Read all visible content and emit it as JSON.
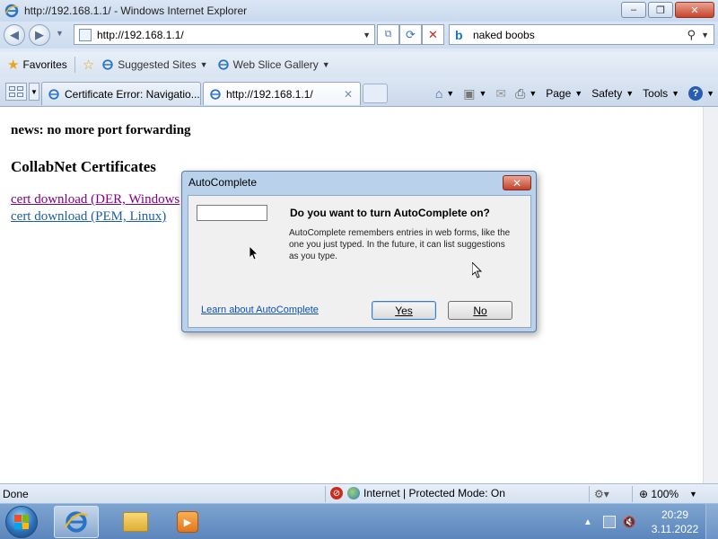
{
  "window": {
    "title": "http://192.168.1.1/ - Windows Internet Explorer",
    "minimize_label": "‒",
    "maximize_label": "❐",
    "close_label": "✕"
  },
  "address_bar": {
    "url": "http://192.168.1.1/",
    "search_query": "naked boobs",
    "search_engine_icon": "bing-icon"
  },
  "favorites_bar": {
    "favorites_label": "Favorites",
    "items": [
      {
        "label": "Suggested Sites"
      },
      {
        "label": "Web Slice Gallery"
      }
    ]
  },
  "tabs": [
    {
      "label": "Certificate Error: Navigatio...",
      "active": false
    },
    {
      "label": "http://192.168.1.1/",
      "active": true
    }
  ],
  "command_bar": {
    "page_label": "Page",
    "safety_label": "Safety",
    "tools_label": "Tools",
    "help_label": "?"
  },
  "page": {
    "news": "news: no more port forwarding",
    "heading": "CollabNet Certificates",
    "links": [
      {
        "label": "cert download (DER, Windows"
      },
      {
        "label": "cert download (PEM, Linux)"
      }
    ]
  },
  "dialog": {
    "title": "AutoComplete",
    "close_label": "✕",
    "question": "Do you want to turn AutoComplete on?",
    "description": "AutoComplete remembers entries in web forms, like the one you just typed. In the future, it can list suggestions as you type.",
    "learn_link": "Learn about AutoComplete",
    "yes_label": "Yes",
    "no_label": "No"
  },
  "status_bar": {
    "status": "Done",
    "zone": "Internet | Protected Mode: On",
    "zoom": "100%"
  },
  "taskbar": {
    "clock_time": "20:29",
    "clock_date": "3.11.2022"
  },
  "colors": {
    "visited_link": "#800080",
    "link": "#1a5fa8",
    "dialog_frame": "#b9d1ea",
    "taskbar": "#5b86bd"
  }
}
